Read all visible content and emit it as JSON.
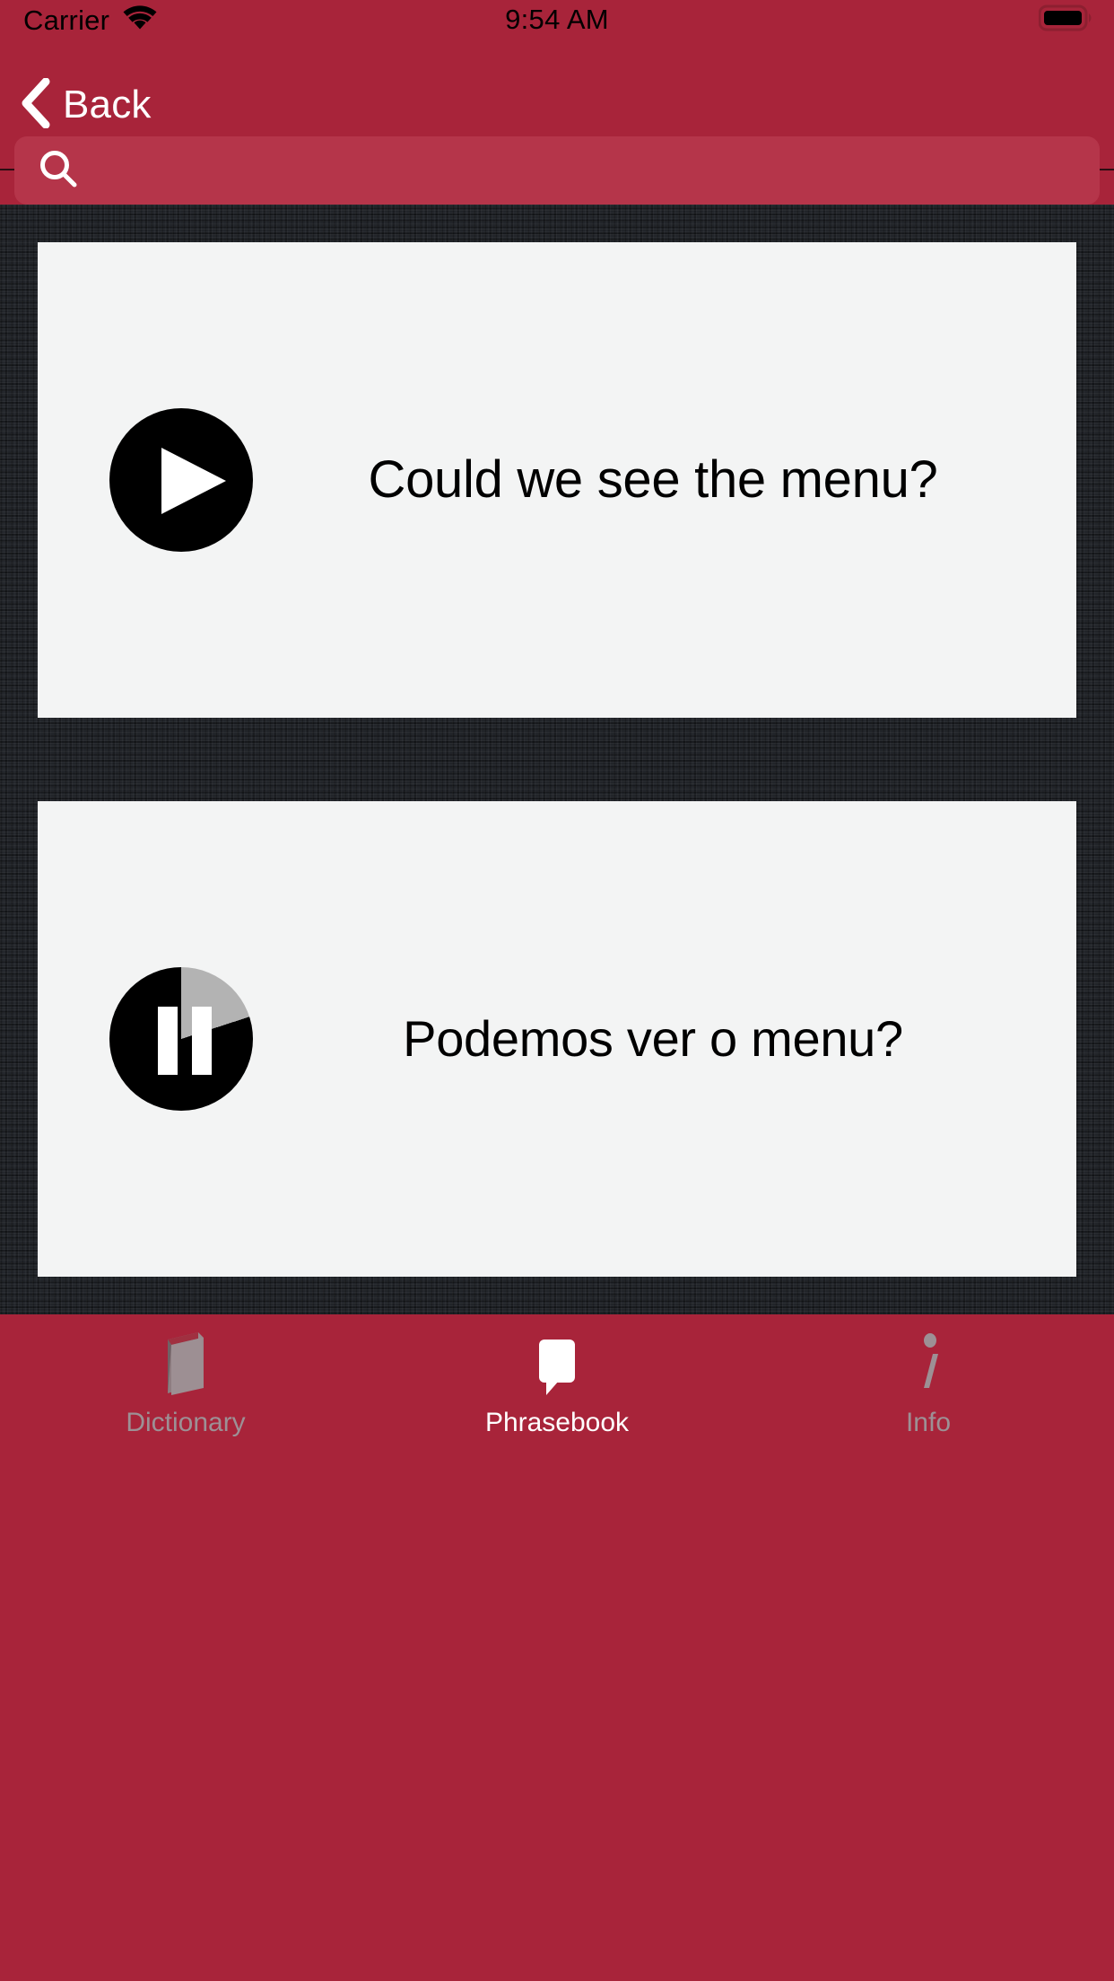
{
  "status_bar": {
    "carrier": "Carrier",
    "time": "9:54 AM",
    "wifi_icon": "wifi-icon",
    "battery_icon": "battery-full-icon"
  },
  "nav_bar": {
    "back_label": "Back",
    "back_icon": "chevron-left-icon"
  },
  "search": {
    "value": "",
    "placeholder": "",
    "icon": "search-icon"
  },
  "phrases": {
    "source": {
      "text": "Could we see the menu?",
      "audio_state": "play",
      "audio_icon": "play-icon"
    },
    "target": {
      "text": "Podemos ver o menu?",
      "audio_state": "pause",
      "audio_icon": "pause-icon",
      "progress_percent": 20
    }
  },
  "tab_bar": {
    "items": [
      {
        "label": "Dictionary",
        "icon": "book-icon",
        "active": false
      },
      {
        "label": "Phrasebook",
        "icon": "speech-bubble-icon",
        "active": true
      },
      {
        "label": "Info",
        "icon": "info-icon",
        "active": false
      }
    ]
  },
  "colors": {
    "brand_red": "#a8243a",
    "search_field": "#b5354a",
    "card_bg": "#f3f4f4",
    "content_bg": "#212429",
    "tab_inactive": "#9d9095",
    "tab_active": "#ffffff"
  }
}
